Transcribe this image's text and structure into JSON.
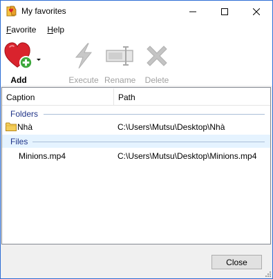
{
  "window": {
    "title": "My favorites"
  },
  "menu": {
    "favorite": "Favorite",
    "help": "Help"
  },
  "toolbar": {
    "add": "Add",
    "execute": "Execute",
    "rename": "Rename",
    "delete": "Delete"
  },
  "list": {
    "columns": {
      "caption": "Caption",
      "path": "Path"
    },
    "groups": {
      "folders": {
        "label": "Folders",
        "items": [
          {
            "caption": "Nhà",
            "path": "C:\\Users\\Mutsu\\Desktop\\Nhà"
          }
        ]
      },
      "files": {
        "label": "Files",
        "items": [
          {
            "caption": "Minions.mp4",
            "path": "C:\\Users\\Mutsu\\Desktop\\Minions.mp4"
          }
        ]
      }
    }
  },
  "footer": {
    "close": "Close"
  },
  "colors": {
    "accent": "#2b6cd4",
    "group_text": "#1e3287",
    "selection": "#e5f3ff",
    "heart": "#d9232d",
    "plus": "#3ca83c"
  }
}
